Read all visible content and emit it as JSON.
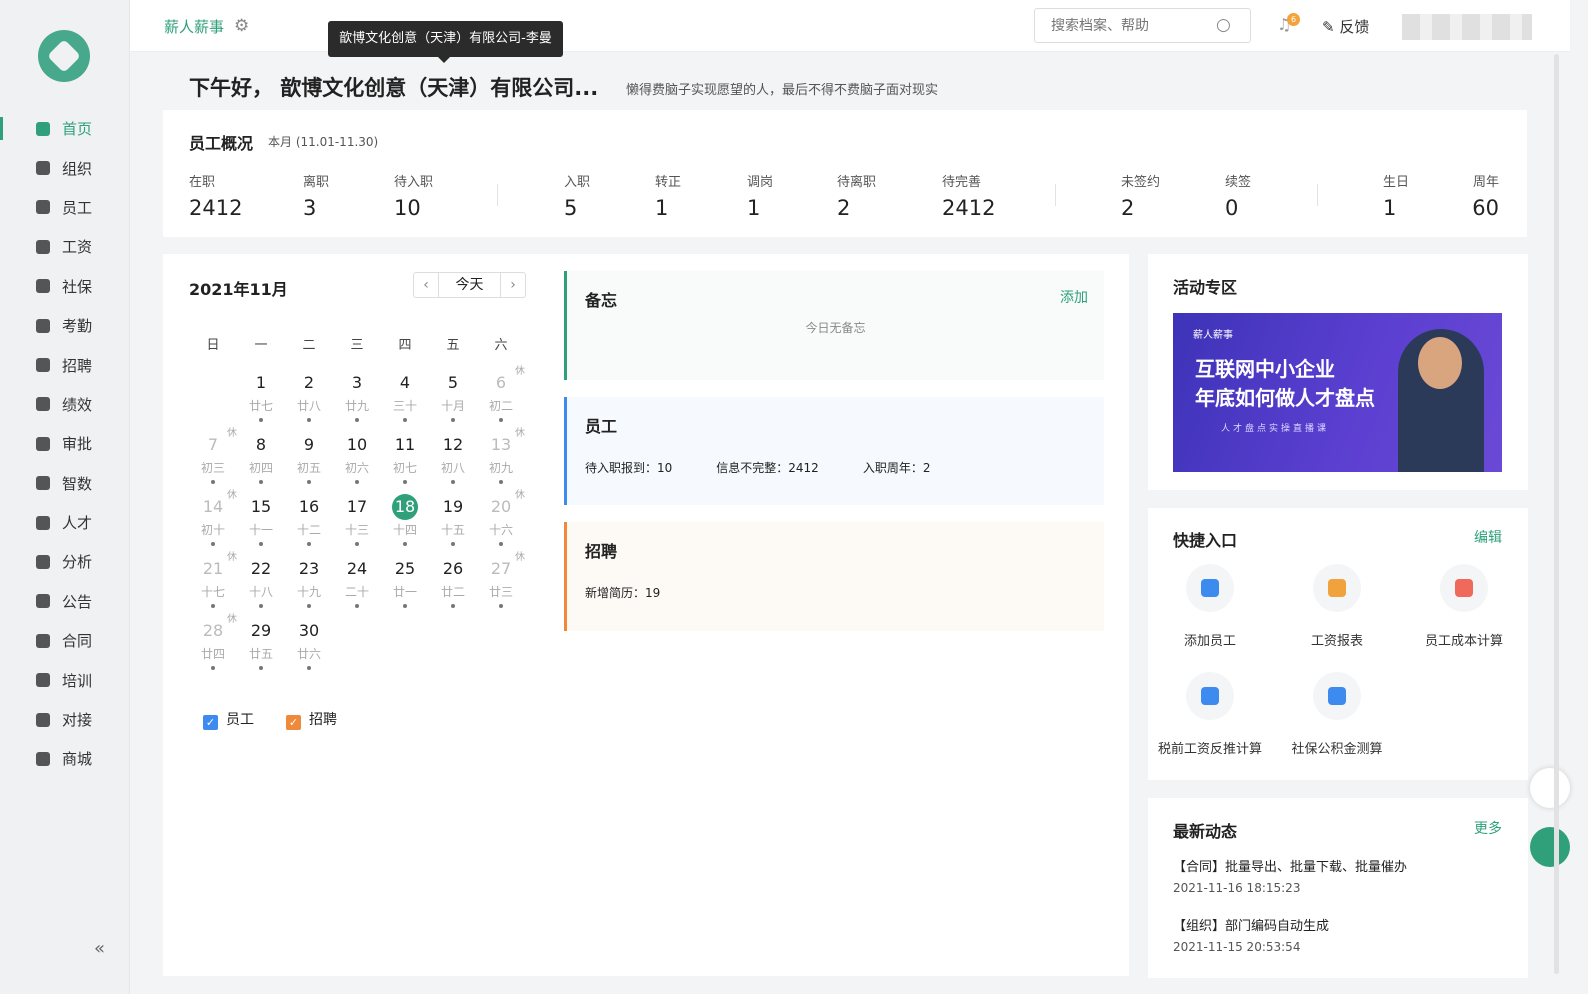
{
  "sidebar": {
    "items": [
      {
        "label": "首页",
        "icon": "home-icon"
      },
      {
        "label": "组织",
        "icon": "org-icon"
      },
      {
        "label": "员工",
        "icon": "user-icon"
      },
      {
        "label": "工资",
        "icon": "salary-icon"
      },
      {
        "label": "社保",
        "icon": "shield-icon"
      },
      {
        "label": "考勤",
        "icon": "calendar-icon"
      },
      {
        "label": "招聘",
        "icon": "recruit-icon"
      },
      {
        "label": "绩效",
        "icon": "performance-icon"
      },
      {
        "label": "审批",
        "icon": "approval-icon"
      },
      {
        "label": "智数",
        "icon": "pie-icon"
      },
      {
        "label": "人才",
        "icon": "graduation-icon"
      },
      {
        "label": "分析",
        "icon": "bar-chart-icon"
      },
      {
        "label": "公告",
        "icon": "notice-icon"
      },
      {
        "label": "合同",
        "icon": "contract-icon"
      },
      {
        "label": "培训",
        "icon": "training-icon"
      },
      {
        "label": "对接",
        "icon": "link-icon"
      },
      {
        "label": "商城",
        "icon": "store-icon"
      }
    ],
    "collapse_label": "«"
  },
  "topbar": {
    "brand": "薪人薪事",
    "search_placeholder": "搜索档案、帮助",
    "bell_count": "6",
    "feedback": "反馈",
    "tooltip": "歆博文化创意（天津）有限公司-李曼"
  },
  "greeting": {
    "text": "下午好， 歆博文化创意（天津）有限公司...",
    "motto": "懒得费脑子实现愿望的人，最后不得不费脑子面对现实"
  },
  "overview": {
    "title": "员工概况",
    "period": "本月 (11.01-11.30)",
    "stats": [
      {
        "label": "在职",
        "value": "2412"
      },
      {
        "label": "离职",
        "value": "3"
      },
      {
        "label": "待入职",
        "value": "10"
      },
      {
        "label": "入职",
        "value": "5"
      },
      {
        "label": "转正",
        "value": "1"
      },
      {
        "label": "调岗",
        "value": "1"
      },
      {
        "label": "待离职",
        "value": "2"
      },
      {
        "label": "待完善",
        "value": "2412"
      },
      {
        "label": "未签约",
        "value": "2"
      },
      {
        "label": "续签",
        "value": "0"
      },
      {
        "label": "生日",
        "value": "1"
      },
      {
        "label": "周年",
        "value": "60"
      }
    ]
  },
  "calendar": {
    "title": "2021年11月",
    "today_label": "今天",
    "weekdays": [
      "日",
      "一",
      "二",
      "三",
      "四",
      "五",
      "六"
    ],
    "rest_mark": "休",
    "days": [
      {
        "num": "",
        "lunar": ""
      },
      {
        "num": "1",
        "lunar": "廿七",
        "dot": true
      },
      {
        "num": "2",
        "lunar": "廿八",
        "dot": true
      },
      {
        "num": "3",
        "lunar": "廿九",
        "dot": true
      },
      {
        "num": "4",
        "lunar": "三十",
        "dot": true
      },
      {
        "num": "5",
        "lunar": "十月",
        "dot": true
      },
      {
        "num": "6",
        "lunar": "初二",
        "dot": true,
        "dim": true,
        "rest": true
      },
      {
        "num": "7",
        "lunar": "初三",
        "dot": true,
        "dim": true,
        "rest": true
      },
      {
        "num": "8",
        "lunar": "初四",
        "dot": true
      },
      {
        "num": "9",
        "lunar": "初五",
        "dot": true
      },
      {
        "num": "10",
        "lunar": "初六",
        "dot": true
      },
      {
        "num": "11",
        "lunar": "初七",
        "dot": true
      },
      {
        "num": "12",
        "lunar": "初八",
        "dot": true
      },
      {
        "num": "13",
        "lunar": "初九",
        "dot": true,
        "dim": true,
        "rest": true
      },
      {
        "num": "14",
        "lunar": "初十",
        "dot": true,
        "dim": true,
        "rest": true
      },
      {
        "num": "15",
        "lunar": "十一",
        "dot": true
      },
      {
        "num": "16",
        "lunar": "十二",
        "dot": true
      },
      {
        "num": "17",
        "lunar": "十三",
        "dot": true
      },
      {
        "num": "18",
        "lunar": "十四",
        "dot": true,
        "today": true
      },
      {
        "num": "19",
        "lunar": "十五",
        "dot": true
      },
      {
        "num": "20",
        "lunar": "十六",
        "dot": true,
        "dim": true,
        "rest": true
      },
      {
        "num": "21",
        "lunar": "十七",
        "dot": true,
        "dim": true,
        "rest": true
      },
      {
        "num": "22",
        "lunar": "十八",
        "dot": true
      },
      {
        "num": "23",
        "lunar": "十九",
        "dot": true
      },
      {
        "num": "24",
        "lunar": "二十",
        "dot": true
      },
      {
        "num": "25",
        "lunar": "廿一",
        "dot": true
      },
      {
        "num": "26",
        "lunar": "廿二",
        "dot": true
      },
      {
        "num": "27",
        "lunar": "廿三",
        "dot": true,
        "dim": true,
        "rest": true
      },
      {
        "num": "28",
        "lunar": "廿四",
        "dot": true,
        "dim": true,
        "rest": true
      },
      {
        "num": "29",
        "lunar": "廿五",
        "dot": true
      },
      {
        "num": "30",
        "lunar": "廿六",
        "dot": true
      }
    ],
    "legend": [
      {
        "label": "员工",
        "color": "#3d8bef"
      },
      {
        "label": "招聘",
        "color": "#ef8a3d"
      }
    ]
  },
  "memo": {
    "title": "备忘",
    "add": "添加",
    "empty": "今日无备忘"
  },
  "employee_panel": {
    "title": "员工",
    "items": [
      "待入职报到：10",
      "信息不完整：2412",
      "入职周年：2"
    ]
  },
  "recruit_panel": {
    "title": "招聘",
    "text": "新增简历：19"
  },
  "activity": {
    "title": "活动专区",
    "banner_tag": "薪人薪事",
    "banner_line1": "互联网中小企业",
    "banner_line2": "年底如何做人才盘点",
    "banner_sub": "人才盘点实操直播课"
  },
  "quick": {
    "title": "快捷入口",
    "edit": "编辑",
    "items": [
      {
        "label": "添加员工",
        "color": "#3d8bef"
      },
      {
        "label": "工资报表",
        "color": "#f0a23d"
      },
      {
        "label": "员工成本计算",
        "color": "#ef6a5a"
      },
      {
        "label": "税前工资反推计算",
        "color": "#3d8bef"
      },
      {
        "label": "社保公积金测算",
        "color": "#3d8bef"
      }
    ]
  },
  "news": {
    "title": "最新动态",
    "more": "更多",
    "items": [
      {
        "text": "【合同】批量导出、批量下载、批量催办",
        "time": "2021-11-16 18:15:23"
      },
      {
        "text": "【组织】部门编码自动生成",
        "time": "2021-11-15 20:53:54"
      }
    ]
  }
}
